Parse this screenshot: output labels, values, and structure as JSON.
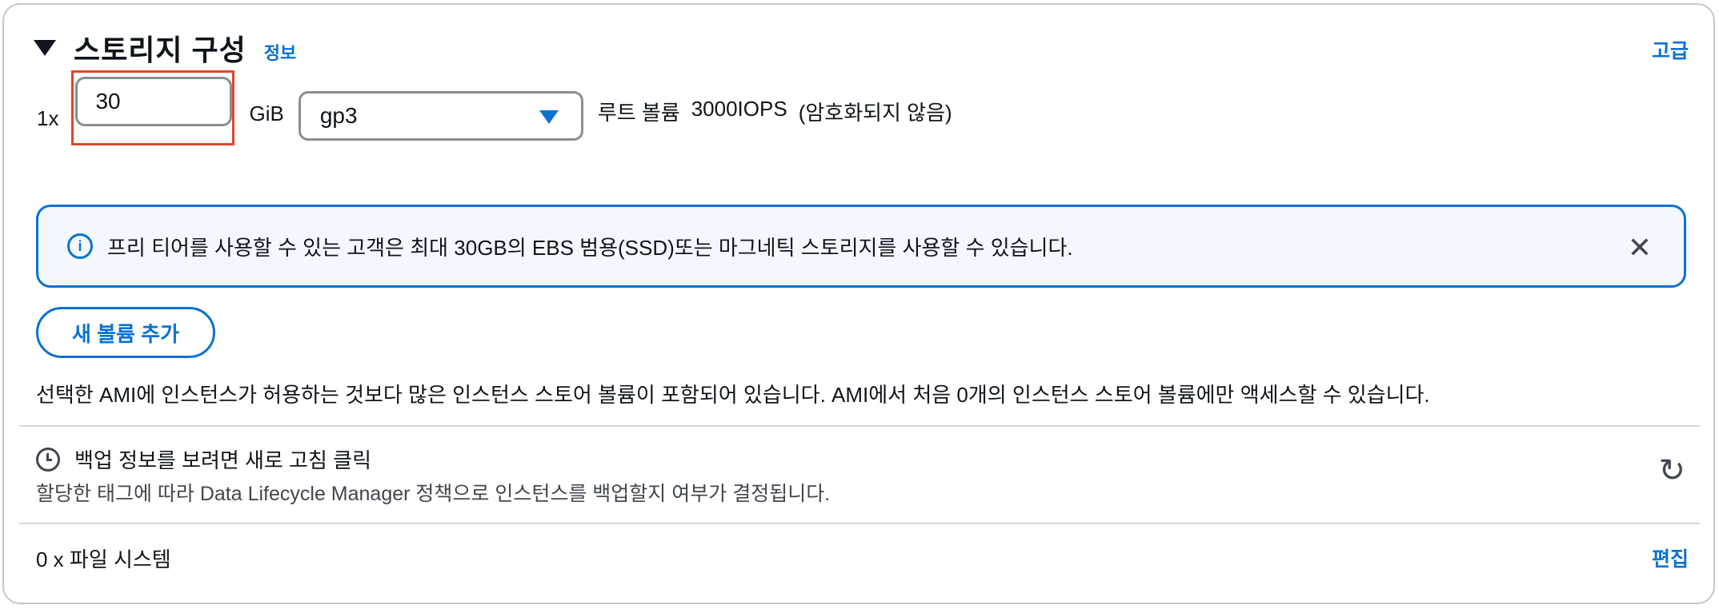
{
  "header": {
    "title": "스토리지 구성",
    "info_link": "정보",
    "advanced_link": "고급"
  },
  "volume": {
    "multiplier": "1x",
    "size_value": "30",
    "unit": "GiB",
    "type_selected": "gp3",
    "root_label": "루트 볼륨",
    "iops": "3000IOPS",
    "encryption": "(암호화되지 않음)"
  },
  "alert": {
    "icon": "info-icon",
    "text": "프리 티어를 사용할 수 있는 고객은 최대 30GB의 EBS 범용(SSD)또는 마그네틱 스토리지를 사용할 수 있습니다.",
    "close_glyph": "✕"
  },
  "add_volume_button": "새 볼륨 추가",
  "ami_notice": "선택한 AMI에 인스턴스가 허용하는 것보다 많은 인스턴스 스토어 볼륨이 포함되어 있습니다. AMI에서 처음 0개의 인스턴스 스토어 볼륨에만 액세스할 수 있습니다.",
  "backup": {
    "title": "백업 정보를 보려면 새로 고침 클릭",
    "subtitle": "할당한 태그에 따라 Data Lifecycle Manager 정책으로 인스턴스를 백업할지 여부가 결정됩니다.",
    "refresh_glyph": "↻"
  },
  "file_systems": {
    "label": "0 x 파일 시스템",
    "edit_link": "편집"
  },
  "colors": {
    "accent": "#0972d3",
    "highlight": "#e0452b",
    "alert_bg": "#f2f8fd"
  }
}
